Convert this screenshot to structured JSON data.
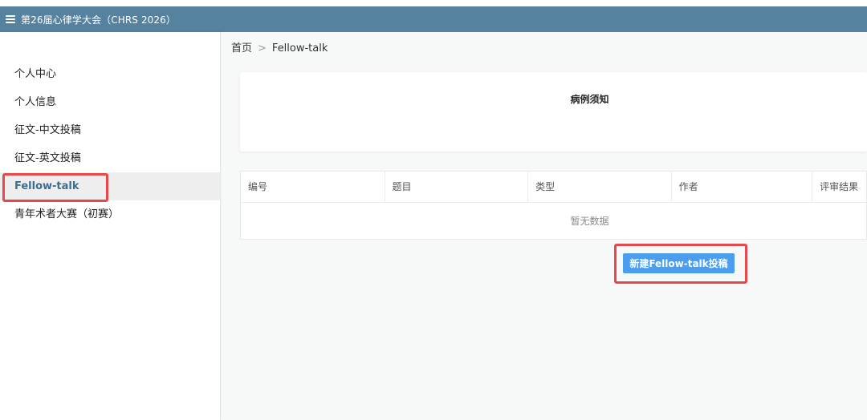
{
  "header": {
    "title": "第26届心律学大会（CHRS 2026）"
  },
  "sidebar": {
    "items": [
      {
        "label": "个人中心"
      },
      {
        "label": "个人信息"
      },
      {
        "label": "征文-中文投稿"
      },
      {
        "label": "征文-英文投稿"
      },
      {
        "label": "Fellow-talk",
        "active": true
      },
      {
        "label": "青年术者大赛（初赛）"
      }
    ]
  },
  "breadcrumb": {
    "home": "首页",
    "separator": ">",
    "current": "Fellow-talk"
  },
  "notice": {
    "title": "病例须知"
  },
  "table": {
    "columns": [
      "编号",
      "题目",
      "类型",
      "作者",
      "评审结果"
    ],
    "empty_text": "暂无数据"
  },
  "actions": {
    "new_button": "新建Fellow-talk投稿"
  },
  "colors": {
    "header": "#54829f",
    "accent": "#4a9eed",
    "active_text": "#3b6e90",
    "annotation": "#e8474c"
  }
}
